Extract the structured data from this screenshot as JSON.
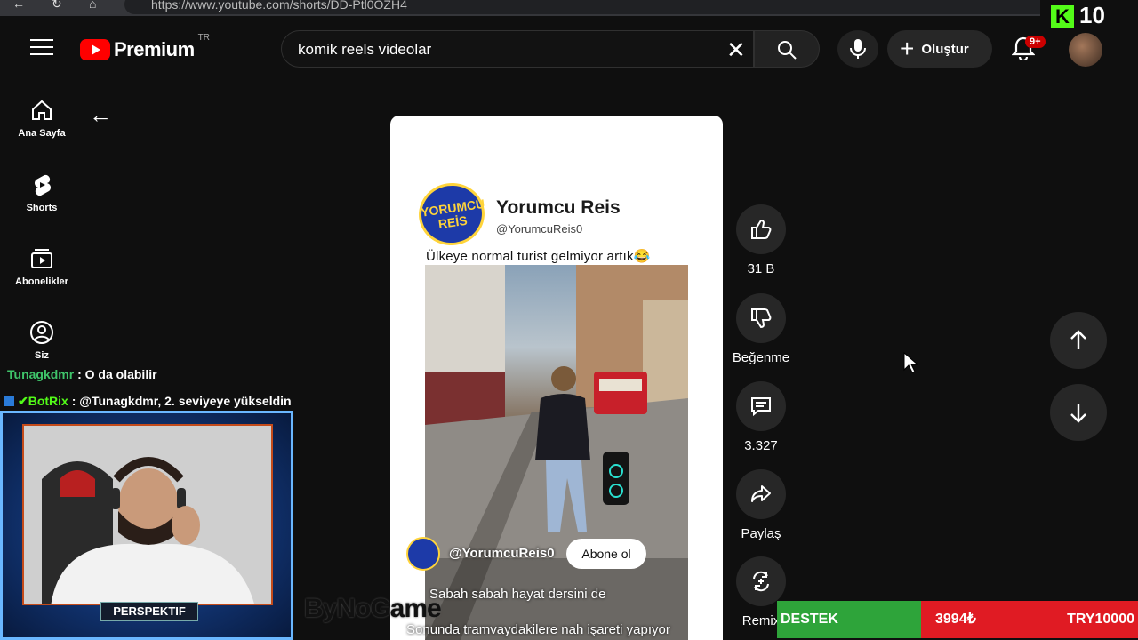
{
  "browser": {
    "url": "https://www.youtube.com/shorts/DD-Ptl0OZH4"
  },
  "header": {
    "logo_text": "Premium",
    "region": "TR",
    "search_value": "komik reels videolar",
    "create_label": "Oluştur",
    "notification_count": "9+"
  },
  "kick": {
    "logo": "K",
    "count": "10"
  },
  "sidebar": {
    "items": [
      {
        "label": "Ana Sayfa",
        "icon": "home-icon"
      },
      {
        "label": "Shorts",
        "icon": "shorts-icon"
      },
      {
        "label": "Abonelikler",
        "icon": "subscriptions-icon"
      },
      {
        "label": "Siz",
        "icon": "you-icon"
      }
    ]
  },
  "short": {
    "channel_logo_text": "YORUMCU REİS",
    "channel_name": "Yorumcu Reis",
    "channel_handle": "@YorumcuReis0",
    "caption": "Ülkeye normal turist gelmiyor artık😂",
    "overlay_handle": "@YorumcuReis0",
    "subscribe_label": "Abone ol",
    "description_line1": "Sabah sabah hayat dersini de",
    "description_line2": "Sonunda tramvaydakilere nah işareti yapıyor"
  },
  "actions": {
    "likes": "31 B",
    "dislike_label": "Beğenme",
    "comments": "3.327",
    "share_label": "Paylaş",
    "remix_label": "Remix"
  },
  "stream": {
    "chat": [
      {
        "user": "Tunagkdmr",
        "message": " : O da olabilir"
      },
      {
        "user": "BotRix",
        "message": " : @Tunagkdmr, 2. seviyeye yükseldin"
      }
    ],
    "cam_label": "PERSPEKTIF",
    "watermark": "ByNoGame",
    "donation": {
      "label": "DESTEK",
      "amount": "3994₺",
      "goal": "TRY10000"
    }
  },
  "colors": {
    "background": "#0f0f0f",
    "youtube_red": "#ff0000",
    "button_bg": "#272727",
    "donation_green": "#2ea43a",
    "donation_red": "#e01b23"
  }
}
